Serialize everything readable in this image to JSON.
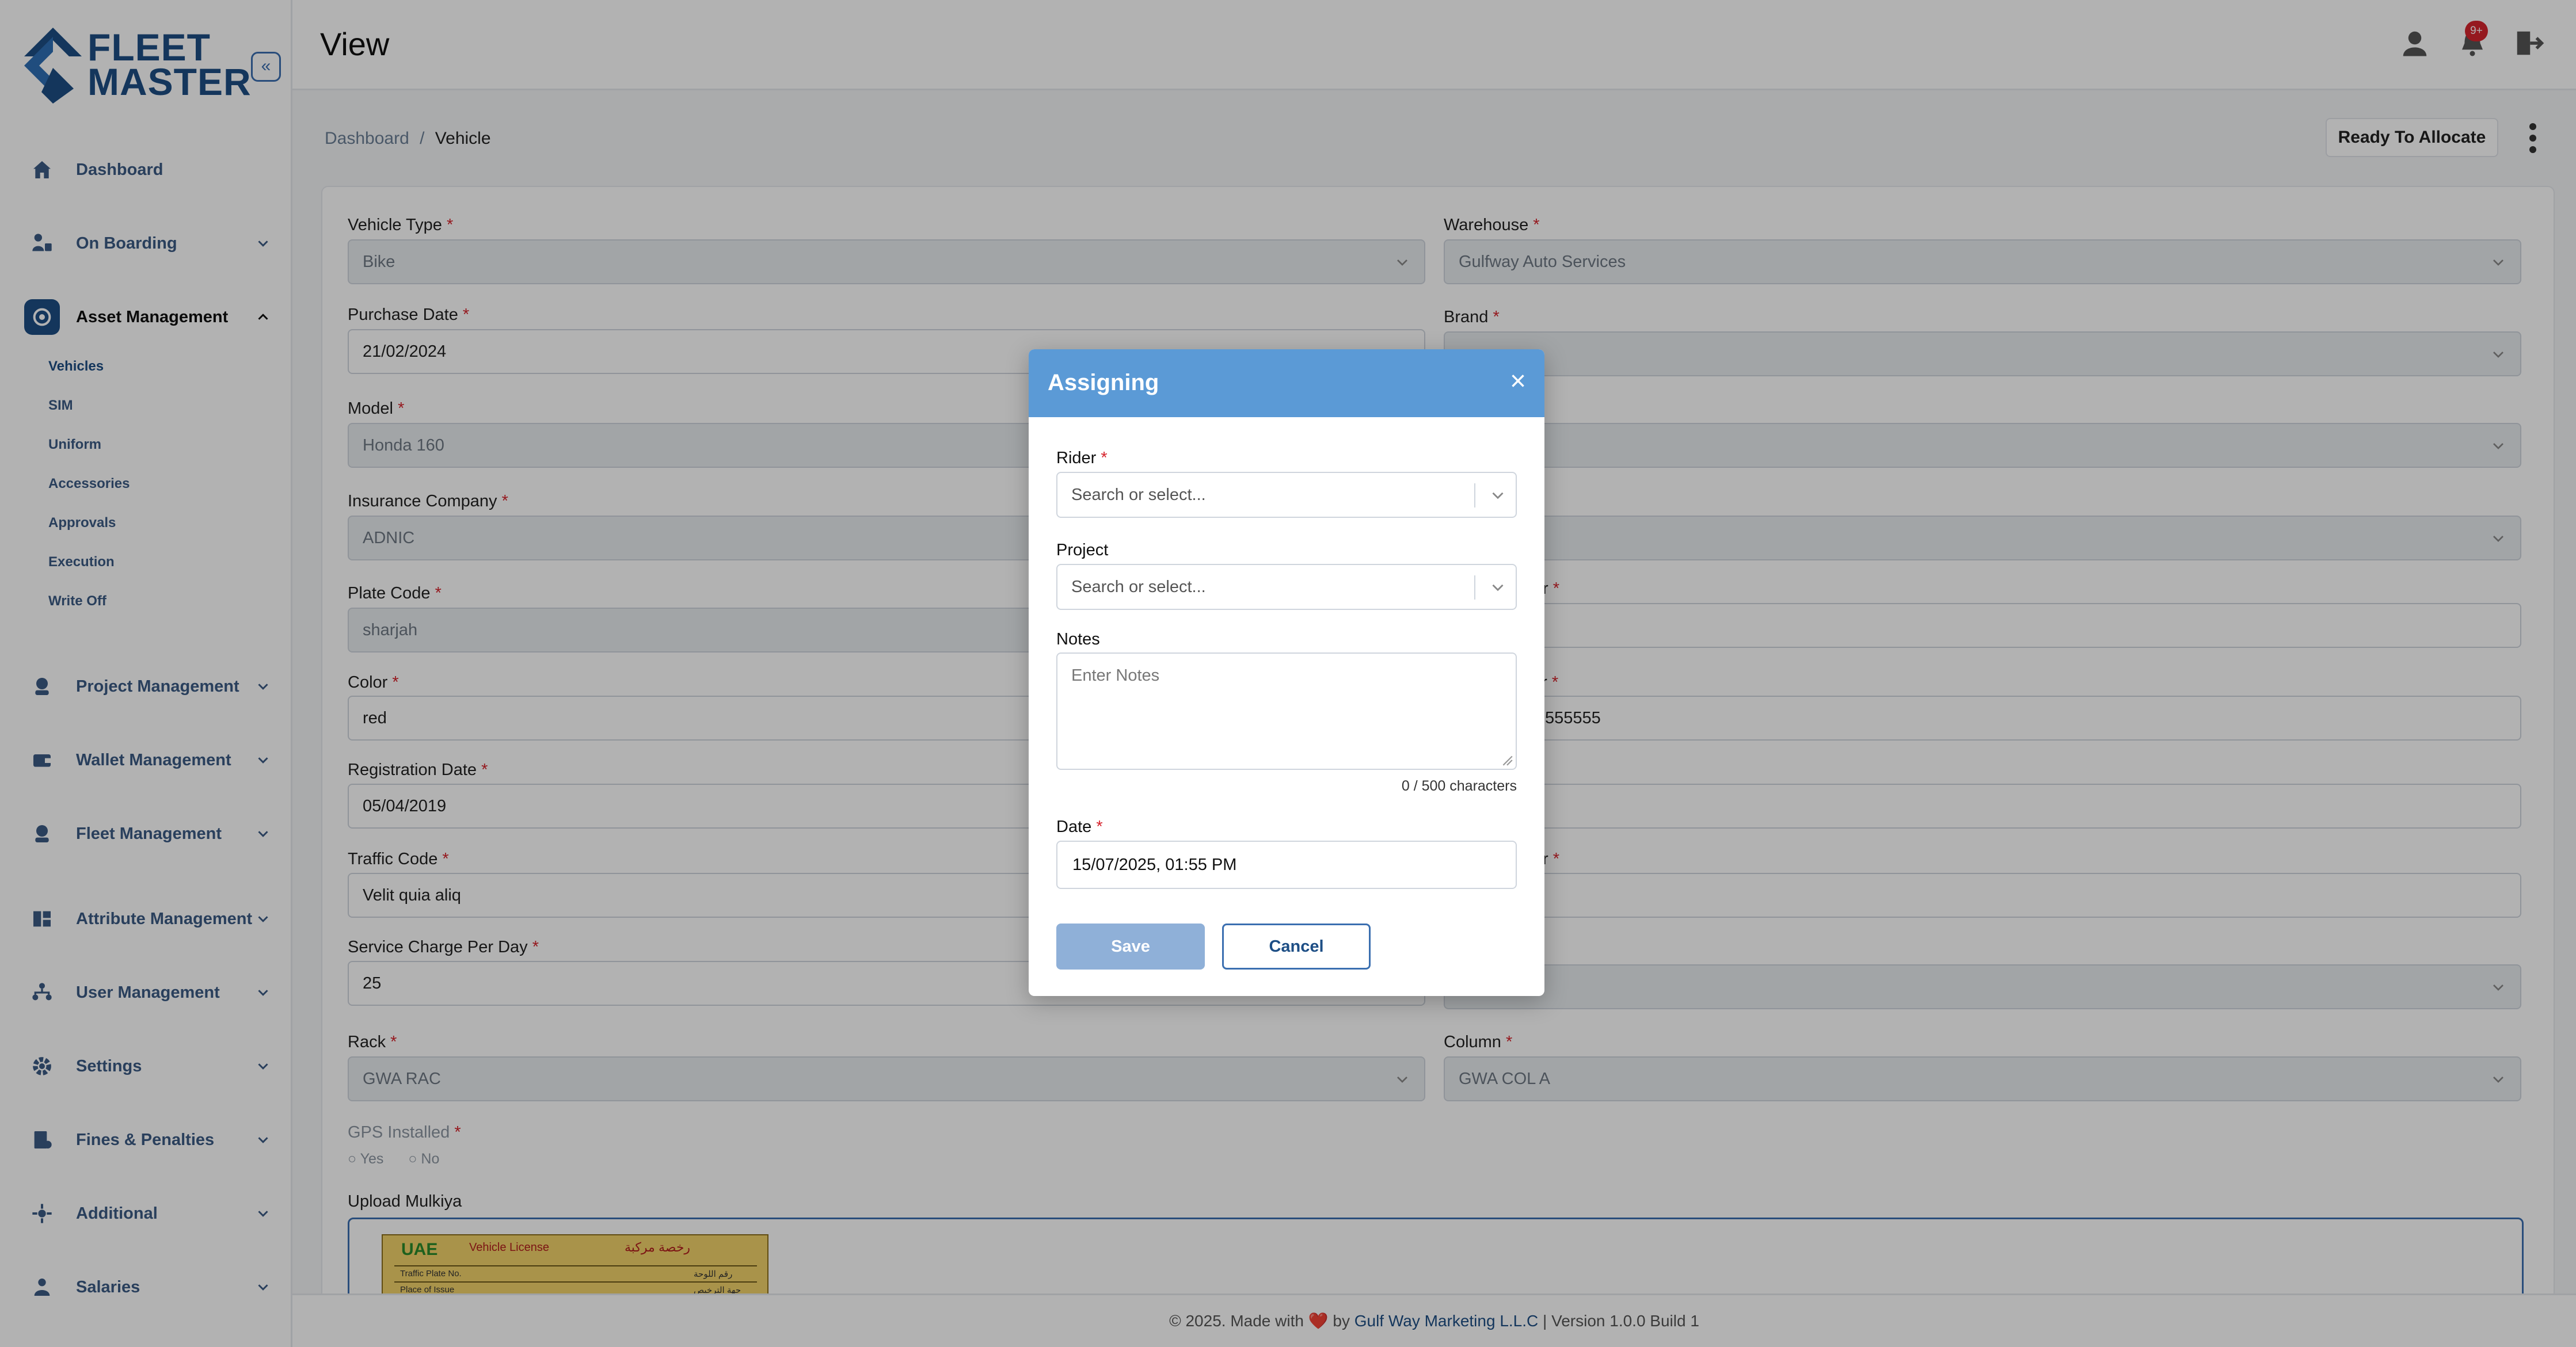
{
  "app": {
    "logo_line1": "FLEET",
    "logo_line2": "MASTER",
    "collapse_glyph": "«"
  },
  "header": {
    "title": "View",
    "notif_badge": "9+",
    "icons": [
      "user-icon",
      "bell-icon",
      "logout-icon"
    ]
  },
  "sidebar": {
    "items": [
      {
        "label": "Dashboard",
        "icon": "home-icon",
        "has_chevron": false
      },
      {
        "label": "On Boarding",
        "icon": "onboarding-icon",
        "has_chevron": true
      },
      {
        "label": "Asset Management",
        "icon": "asset-icon",
        "has_chevron": true,
        "expanded": true
      },
      {
        "label": "Project Management",
        "icon": "project-icon",
        "has_chevron": true
      },
      {
        "label": "Wallet Management",
        "icon": "wallet-icon",
        "has_chevron": true
      },
      {
        "label": "Fleet Management",
        "icon": "fleet-icon",
        "has_chevron": true
      },
      {
        "label": "Attribute Management",
        "icon": "attribute-icon",
        "has_chevron": true
      },
      {
        "label": "User Management",
        "icon": "users-icon",
        "has_chevron": true
      },
      {
        "label": "Settings",
        "icon": "gear-icon",
        "has_chevron": true
      },
      {
        "label": "Fines & Penalties",
        "icon": "fines-icon",
        "has_chevron": true
      },
      {
        "label": "Additional",
        "icon": "additional-icon",
        "has_chevron": true
      },
      {
        "label": "Salaries",
        "icon": "salaries-icon",
        "has_chevron": true
      }
    ],
    "sub_items": [
      "Vehicles",
      "SIM",
      "Uniform",
      "Accessories",
      "Approvals",
      "Execution",
      "Write Off"
    ]
  },
  "breadcrumb": {
    "root": "Dashboard",
    "sep": "/",
    "current": "Vehicle"
  },
  "actions": {
    "ready_label": "Ready To Allocate"
  },
  "form": {
    "vehicle_type": {
      "label": "Vehicle Type",
      "value": "Bike"
    },
    "warehouse": {
      "label": "Warehouse",
      "value": "Gulfway Auto Services"
    },
    "purchase_date": {
      "label": "Purchase Date",
      "value": "21/02/2024"
    },
    "brand": {
      "label": "Brand",
      "value": ""
    },
    "model": {
      "label": "Model",
      "value": "Honda 160"
    },
    "insurance_company": {
      "label": "Insurance Company",
      "value": "ADNIC"
    },
    "plate_code": {
      "label": "Plate Code",
      "value": "sharjah"
    },
    "right_label_5": "r",
    "color": {
      "label": "Color",
      "value": "red"
    },
    "right_label_6": "er",
    "right_value_6": "555555",
    "registration_date": {
      "label": "Registration Date",
      "value": "05/04/2019"
    },
    "traffic_code": {
      "label": "Traffic Code",
      "value": "Velit quia aliq"
    },
    "right_label_8": "r",
    "service_charge": {
      "label": "Service Charge Per Day",
      "value": "25"
    },
    "rack": {
      "label": "Rack",
      "value": "GWA RAC"
    },
    "column": {
      "label": "Column",
      "value": "GWA COL A"
    },
    "gps": {
      "label": "GPS Installed",
      "yes": "Yes",
      "no": "No"
    },
    "upload": {
      "label": "Upload Mulkiya",
      "doc_uae": "UAE",
      "doc_title": "Vehicle License",
      "doc_title_ar": "رخصة مركبة",
      "doc_row1": "Traffic Plate No.",
      "doc_row2": "Place of Issue",
      "doc_row1_ar": "رقم اللوحة",
      "doc_row2_ar": "جهة الترخيص"
    },
    "req": "*"
  },
  "modal": {
    "title": "Assigning",
    "close": "×",
    "rider_label": "Rider",
    "rider_placeholder": "Search or select...",
    "project_label": "Project",
    "project_placeholder": "Search or select...",
    "notes_label": "Notes",
    "notes_placeholder": "Enter Notes",
    "char_count": "0 / 500 characters",
    "date_label": "Date",
    "date_value": "15/07/2025, 01:55 PM",
    "save_label": "Save",
    "cancel_label": "Cancel"
  },
  "footer": {
    "prefix": "© 2025. Made with",
    "heart": "❤️",
    "by": "by",
    "company": "Gulf Way Marketing L.L.C",
    "version": "| Version 1.0.0 Build 1"
  },
  "colors": {
    "brand": "#1d4e85",
    "modal_header": "#5b9ad6",
    "required": "#d6242d"
  }
}
